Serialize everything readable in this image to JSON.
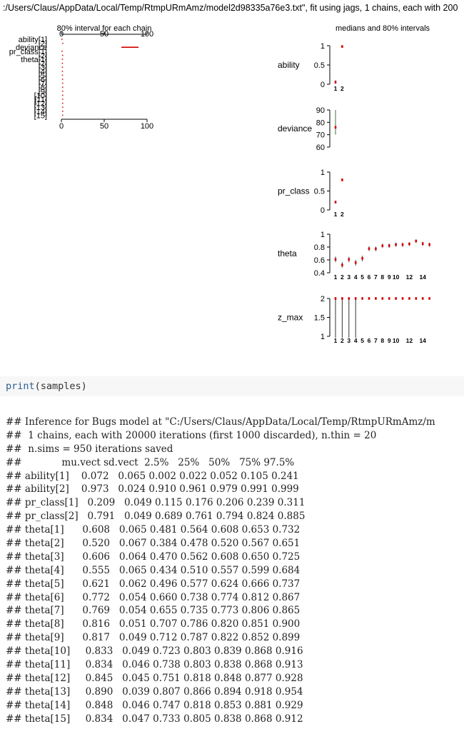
{
  "plot": {
    "title": ":/Users/Claus/AppData/Local/Temp/RtmpURmAmz/model2d98335a76e3.txt\", fit using jags, 1 chains, each with 200",
    "left_panel": {
      "heading": "80% interval for each chain",
      "axis_ticks": [
        "0",
        "50",
        "100"
      ],
      "row_labels": [
        "ability[1]",
        "[2]",
        "deviance",
        "pr_class[1]",
        "[2]",
        "theta[1]",
        "[2]",
        "[3]",
        "[4]",
        "[5]",
        "[6]",
        "[7]",
        "[8]",
        "[9]",
        "[10]",
        "[11]",
        "[12]",
        "[13]",
        "[14]",
        "[15]"
      ]
    },
    "right_heading": "medians and 80% intervals"
  },
  "chart_data": [
    {
      "type": "scatter",
      "label": "ability",
      "x": [
        1,
        2
      ],
      "median": [
        0.052,
        0.979
      ],
      "interval_80": [
        [
          0.022,
          0.105
        ],
        [
          0.961,
          0.991
        ]
      ],
      "y_ticks": [
        "0",
        "0.5",
        "1"
      ],
      "x_ticks": [
        "1",
        "2"
      ],
      "ylim": [
        0,
        1
      ]
    },
    {
      "type": "scatter",
      "label": "deviance",
      "x": [
        1
      ],
      "median": [
        76
      ],
      "interval_80": [
        [
          70,
          90
        ]
      ],
      "y_ticks": [
        "60",
        "70",
        "80",
        "90"
      ],
      "x_ticks": [],
      "ylim": [
        60,
        90
      ]
    },
    {
      "type": "scatter",
      "label": "pr_class",
      "x": [
        1,
        2
      ],
      "median": [
        0.206,
        0.794
      ],
      "interval_80": [
        [
          0.176,
          0.239
        ],
        [
          0.761,
          0.824
        ]
      ],
      "y_ticks": [
        "0",
        "0.5",
        "1"
      ],
      "x_ticks": [
        "1",
        "2"
      ],
      "ylim": [
        0,
        1
      ]
    },
    {
      "type": "scatter",
      "label": "theta",
      "x": [
        1,
        2,
        3,
        4,
        5,
        6,
        7,
        8,
        9,
        10,
        11,
        12,
        13,
        14,
        15
      ],
      "median": [
        0.608,
        0.52,
        0.608,
        0.557,
        0.624,
        0.774,
        0.773,
        0.82,
        0.822,
        0.839,
        0.838,
        0.848,
        0.894,
        0.853,
        0.838
      ],
      "interval_80": [
        [
          0.564,
          0.653
        ],
        [
          0.478,
          0.567
        ],
        [
          0.562,
          0.65
        ],
        [
          0.51,
          0.599
        ],
        [
          0.577,
          0.666
        ],
        [
          0.738,
          0.812
        ],
        [
          0.735,
          0.806
        ],
        [
          0.786,
          0.851
        ],
        [
          0.787,
          0.852
        ],
        [
          0.803,
          0.868
        ],
        [
          0.803,
          0.868
        ],
        [
          0.818,
          0.877
        ],
        [
          0.866,
          0.918
        ],
        [
          0.818,
          0.881
        ],
        [
          0.805,
          0.868
        ]
      ],
      "y_ticks": [
        "0.4",
        "0.6",
        "0.8",
        "1"
      ],
      "x_ticks": [
        "1",
        "2",
        "3",
        "4",
        "5",
        "6",
        "7",
        "8",
        "9",
        "10",
        "12",
        "14"
      ],
      "ylim": [
        0.4,
        1
      ]
    },
    {
      "type": "scatter",
      "label": "z_max",
      "x": [
        1,
        2,
        3,
        4,
        5,
        6,
        7,
        8,
        9,
        10,
        11,
        12,
        13,
        14,
        15
      ],
      "median": [
        2,
        2,
        2,
        2,
        2,
        2,
        2,
        2,
        2,
        2,
        2,
        2,
        2,
        2,
        2
      ],
      "interval_80": [
        [
          1,
          2
        ],
        [
          1,
          2
        ],
        [
          1,
          2
        ],
        [
          1,
          2
        ],
        [
          2,
          2
        ],
        [
          2,
          2
        ],
        [
          2,
          2
        ],
        [
          2,
          2
        ],
        [
          2,
          2
        ],
        [
          2,
          2
        ],
        [
          2,
          2
        ],
        [
          2,
          2
        ],
        [
          2,
          2
        ],
        [
          2,
          2
        ],
        [
          2,
          2
        ]
      ],
      "y_ticks": [
        "1",
        "1.5",
        "2"
      ],
      "x_ticks": [
        "1",
        "2",
        "3",
        "4",
        "5",
        "6",
        "7",
        "8",
        "9",
        "10",
        "12",
        "14"
      ],
      "ylim": [
        1,
        2
      ]
    }
  ],
  "code": {
    "fn": "print",
    "rest": "(samples)"
  },
  "output": {
    "lines": [
      "## Inference for Bugs model at \"C:/Users/Claus/AppData/Local/Temp/RtmpURmAmz/m",
      "##  1 chains, each with 20000 iterations (first 1000 discarded), n.thin = 20",
      "##  n.sims = 950 iterations saved",
      "##             mu.vect sd.vect  2.5%   25%   50%   75% 97.5%",
      "## ability[1]    0.072   0.065 0.002 0.022 0.052 0.105 0.241",
      "## ability[2]    0.973   0.024 0.910 0.961 0.979 0.991 0.999",
      "## pr_class[1]   0.209   0.049 0.115 0.176 0.206 0.239 0.311",
      "## pr_class[2]   0.791   0.049 0.689 0.761 0.794 0.824 0.885",
      "## theta[1]      0.608   0.065 0.481 0.564 0.608 0.653 0.732",
      "## theta[2]      0.520   0.067 0.384 0.478 0.520 0.567 0.651",
      "## theta[3]      0.606   0.064 0.470 0.562 0.608 0.650 0.725",
      "## theta[4]      0.555   0.065 0.434 0.510 0.557 0.599 0.684",
      "## theta[5]      0.621   0.062 0.496 0.577 0.624 0.666 0.737",
      "## theta[6]      0.772   0.054 0.660 0.738 0.774 0.812 0.867",
      "## theta[7]      0.769   0.054 0.655 0.735 0.773 0.806 0.865",
      "## theta[8]      0.816   0.051 0.707 0.786 0.820 0.851 0.900",
      "## theta[9]      0.817   0.049 0.712 0.787 0.822 0.852 0.899",
      "## theta[10]     0.833   0.049 0.723 0.803 0.839 0.868 0.916",
      "## theta[11]     0.834   0.046 0.738 0.803 0.838 0.868 0.913",
      "## theta[12]     0.845   0.045 0.751 0.818 0.848 0.877 0.928",
      "## theta[13]     0.890   0.039 0.807 0.866 0.894 0.918 0.954",
      "## theta[14]     0.848   0.046 0.747 0.818 0.853 0.881 0.929",
      "## theta[15]     0.834   0.047 0.733 0.805 0.838 0.868 0.912"
    ]
  }
}
